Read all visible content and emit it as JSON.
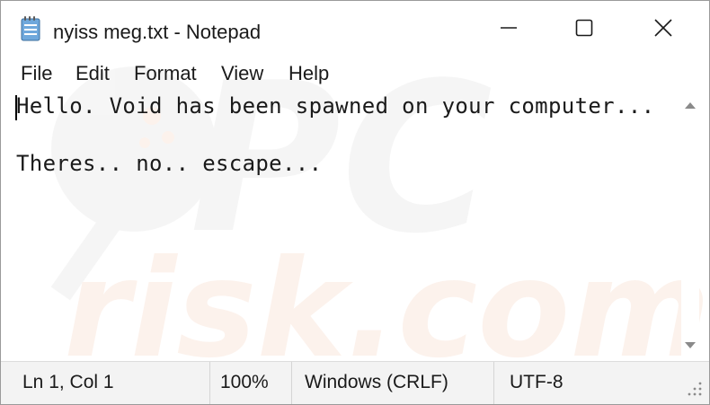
{
  "window": {
    "title": "nyiss meg.txt - Notepad",
    "icon": "notepad-icon",
    "controls": [
      "minimize-icon",
      "maximize-icon",
      "close-icon"
    ]
  },
  "menu": {
    "items": [
      "File",
      "Edit",
      "Format",
      "View",
      "Help"
    ]
  },
  "document": {
    "lines": [
      "Hello. Void has been spawned on your computer...",
      "",
      "Theres.. no.. escape..."
    ]
  },
  "watermark": {
    "top": "PC",
    "bottom": "risk.com"
  },
  "status": {
    "position": "Ln 1, Col 1",
    "zoom": "100%",
    "line_ending": "Windows (CRLF)",
    "encoding": "UTF-8"
  },
  "colors": {
    "text": "#1a1a1a",
    "statusbar_bg": "#f3f3f3",
    "watermark_gray": "#9e9e9e",
    "watermark_orange": "#e8783a"
  }
}
